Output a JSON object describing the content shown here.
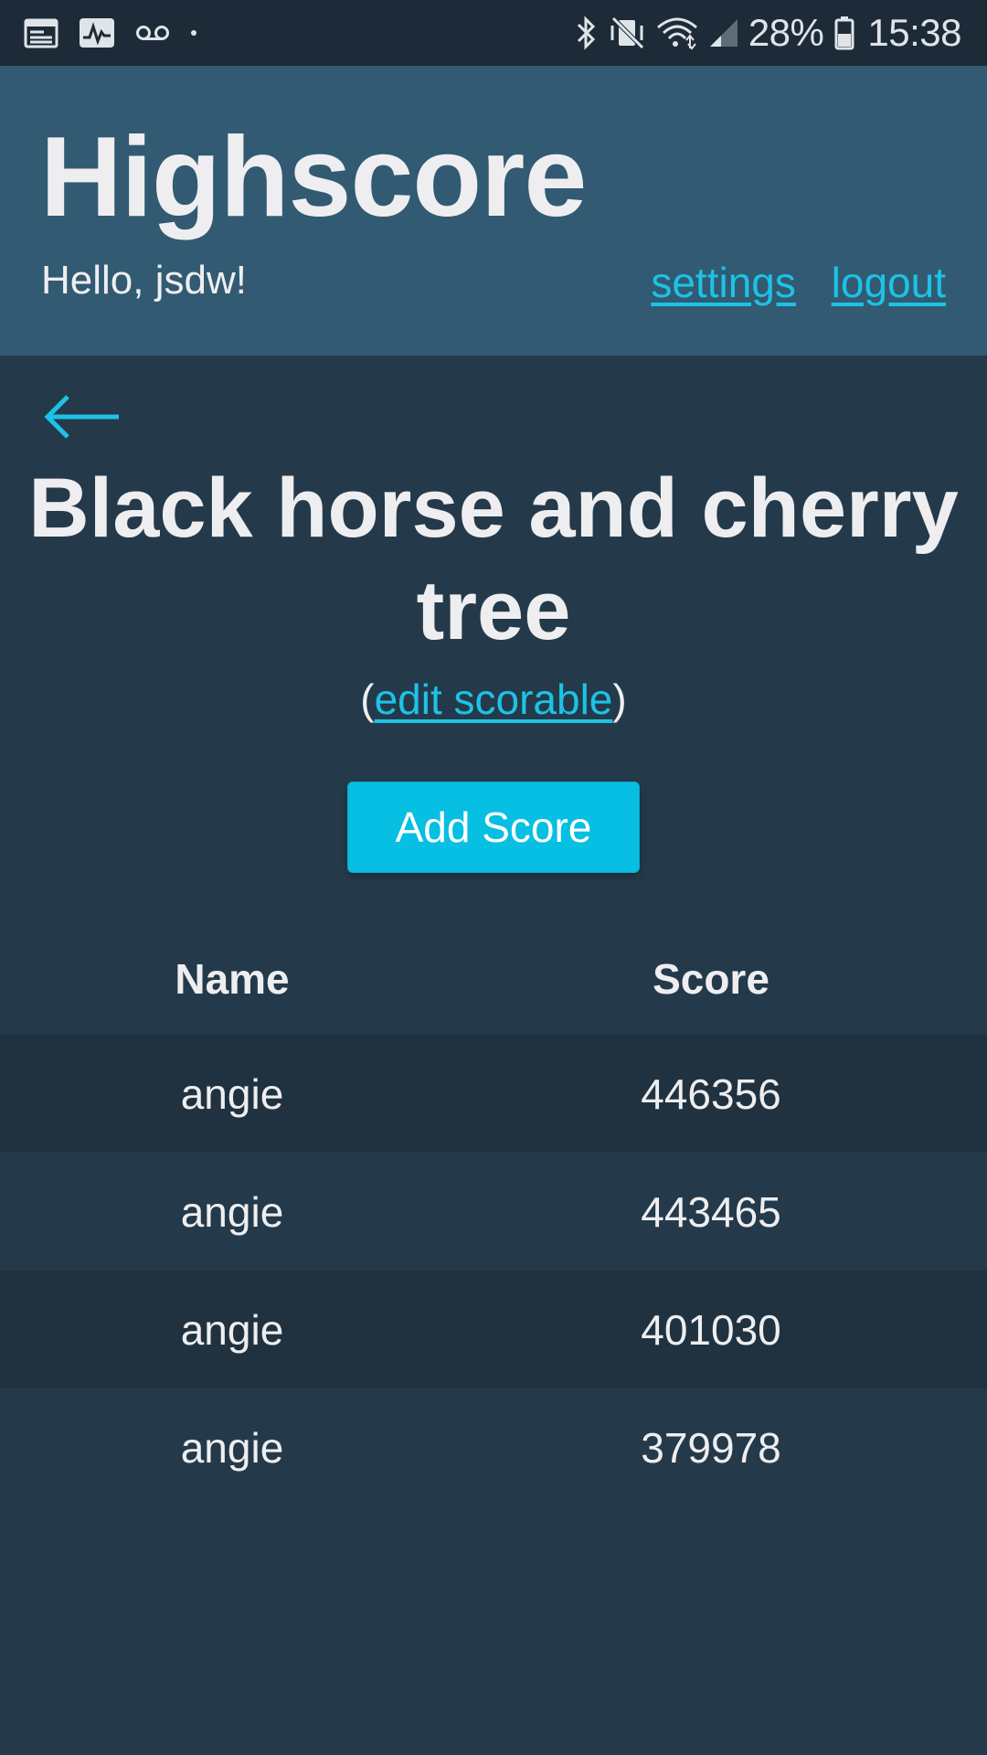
{
  "status_bar": {
    "left_icons": [
      "calendar-icon",
      "activity-icon",
      "voicemail-icon",
      "dot-icon"
    ],
    "right_icons": [
      "bluetooth-icon",
      "vibrate-mute-icon",
      "wifi-icon",
      "signal-icon"
    ],
    "battery_percent": "28%",
    "time": "15:38"
  },
  "header": {
    "app_title": "Highscore",
    "greeting": "Hello, jsdw!",
    "links": {
      "settings": "settings",
      "logout": "logout"
    }
  },
  "main": {
    "back_icon": "back-arrow-icon",
    "scorable_title": "Black horse and cherry tree",
    "edit_open": "(",
    "edit_link": "edit scorable",
    "edit_close": ")",
    "add_score_label": "Add Score"
  },
  "table": {
    "columns": [
      "Name",
      "Score"
    ],
    "rows": [
      {
        "name": "angie",
        "score": "446356"
      },
      {
        "name": "angie",
        "score": "443465"
      },
      {
        "name": "angie",
        "score": "401030"
      },
      {
        "name": "angie",
        "score": "379978"
      }
    ]
  },
  "colors": {
    "status_bar_bg": "#1c2b37",
    "header_bg": "#325a72",
    "page_bg": "#243a4a",
    "row_alt_bg": "#20323f",
    "accent": "#06bfe2",
    "link": "#1cc3e6",
    "text": "#eeeef0"
  }
}
